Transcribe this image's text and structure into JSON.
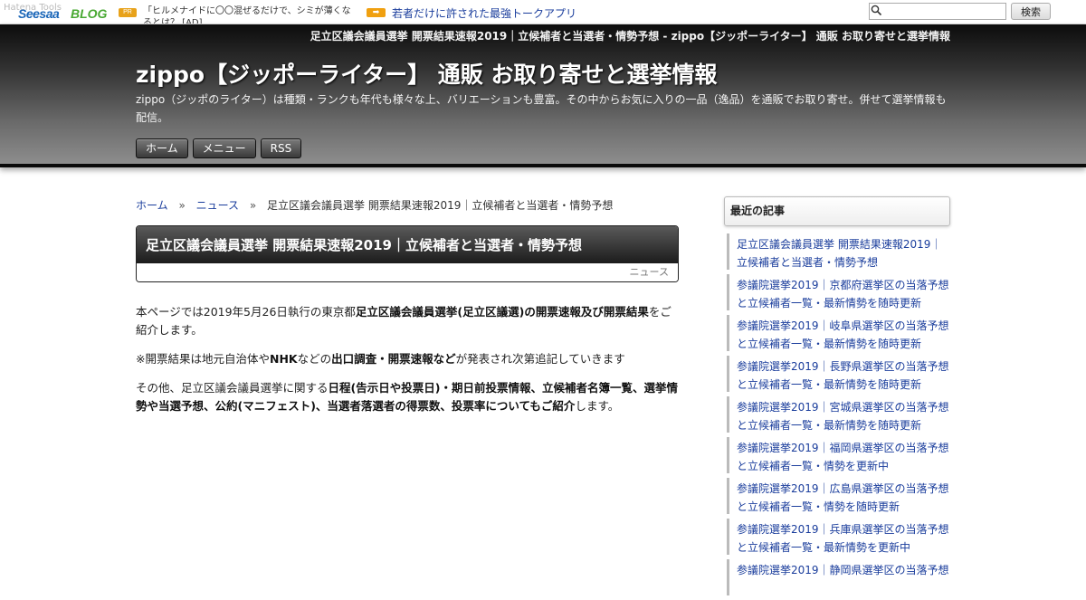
{
  "topbar": {
    "logo_ghost": "Hatena Tools",
    "logo_seesaa": "Seesaa",
    "logo_blog": "BLOG",
    "pr_badge": "PR",
    "ad_text": "「ヒルメナイドに〇〇混ぜるだけで、シミが薄くなるとは？ [AD]",
    "promo_link": "若者だけに許された最強トークアプリ",
    "search_placeholder": "",
    "search_button": "検索"
  },
  "header": {
    "page_heading": "足立区議会議員選挙 開票結果速報2019｜立候補者と当選者・情勢予想 - zippo【ジッポーライター】 通販 お取り寄せと選挙情報",
    "site_title": "zippo【ジッポーライター】 通販 お取り寄せと選挙情報",
    "site_desc": "zippo（ジッポのライター）は種類・ランクも年代も様々な上、バリエーションも豊富。その中からお気に入りの一品（逸品）を通販でお取り寄せ。併せて選挙情報も配信。",
    "nav": [
      "ホーム",
      "メニュー",
      "RSS"
    ]
  },
  "breadcrumb": {
    "home": "ホーム",
    "sep": "»",
    "category": "ニュース",
    "current": "足立区議会議員選挙 開票結果速報2019｜立候補者と当選者・情勢予想"
  },
  "article": {
    "title": "足立区議会議員選挙 開票結果速報2019｜立候補者と当選者・情勢予想",
    "category": "ニュース",
    "p1_a": "本ページでは2019年5月26日執行の東京都",
    "p1_b": "足立区議会議員選挙(足立区議選)の開票速報及び開票結果",
    "p1_c": "をご紹介します。",
    "p2_a": "※開票結果は地元自治体や",
    "p2_b": "NHK",
    "p2_c": "などの",
    "p2_d": "出口調査・開票速報など",
    "p2_e": "が発表され次第追記していきます",
    "p3_a": "その他、足立区議会議員選挙に関する",
    "p3_b": "日程(告示日や投票日)・期日前投票情報、立候補者名簿一覧、選挙情勢や当選予想、公約(マニフェスト)、当選者落選者の得票数、投票率についてもご紹介",
    "p3_c": "します。"
  },
  "sidebar": {
    "heading": "最近の記事",
    "items": [
      "足立区議会議員選挙 開票結果速報2019｜立候補者と当選者・情勢予想",
      "参議院選挙2019｜京都府選挙区の当落予想と立候補者一覧・最新情勢を随時更新",
      "参議院選挙2019｜岐阜県選挙区の当落予想と立候補者一覧・最新情勢を随時更新",
      "参議院選挙2019｜長野県選挙区の当落予想と立候補者一覧・最新情勢を随時更新",
      "参議院選挙2019｜宮城県選挙区の当落予想と立候補者一覧・最新情勢を随時更新",
      "参議院選挙2019｜福岡県選挙区の当落予想と立候補者一覧・情勢を更新中",
      "参議院選挙2019｜広島県選挙区の当落予想と立候補者一覧・情勢を随時更新",
      "参議院選挙2019｜兵庫県選挙区の当落予想と立候補者一覧・最新情勢を更新中",
      "参議院選挙2019｜静岡県選挙区の当落予想"
    ]
  },
  "colors": {
    "link": "#1a3d9c",
    "header_dark": "#0c0c0c",
    "header_light": "#8d8d8d"
  }
}
